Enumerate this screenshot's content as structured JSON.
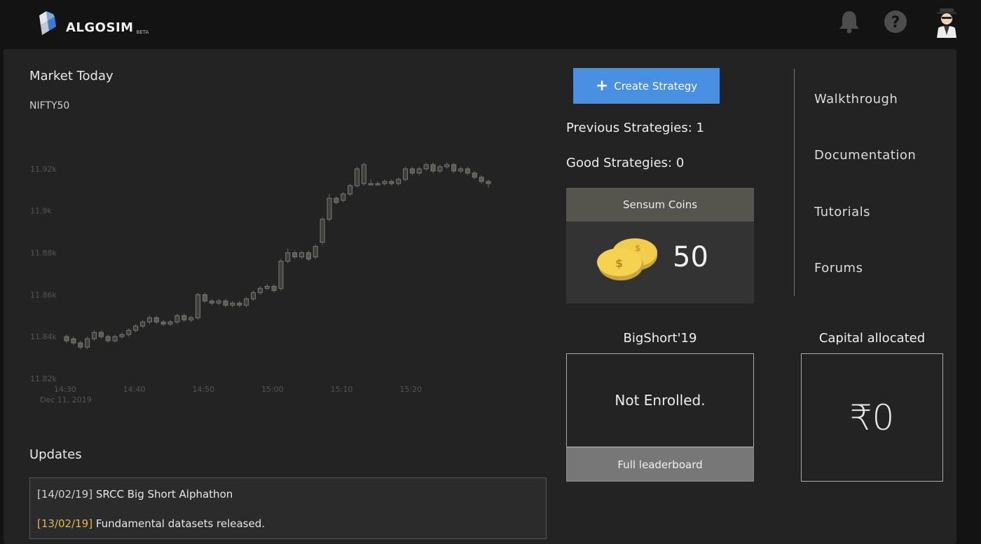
{
  "header": {
    "app_name": "ALGOSIM",
    "badge": "BETA"
  },
  "market": {
    "title": "Market Today",
    "index": "NIFTY50"
  },
  "chart_data": {
    "type": "candlestick",
    "x_date_label": "Dec 11, 2019",
    "x_ticks": [
      "14:30",
      "14:40",
      "14:50",
      "15:00",
      "15:10",
      "15:20"
    ],
    "y_ticks": [
      "11.82k",
      "11.84k",
      "11.86k",
      "11.88k",
      "11.9k",
      "11.92k"
    ],
    "ylim": [
      11820,
      11932
    ],
    "x_start_minute": 0,
    "x_end_minute": 60,
    "grid": false,
    "candles": [
      {
        "t": 0,
        "o": 11840,
        "c": 11838,
        "h": 11841,
        "l": 11837
      },
      {
        "t": 1,
        "o": 11839,
        "c": 11837,
        "h": 11840,
        "l": 11836
      },
      {
        "t": 2,
        "o": 11837,
        "c": 11835,
        "h": 11838,
        "l": 11834
      },
      {
        "t": 3,
        "o": 11835,
        "c": 11839,
        "h": 11840,
        "l": 11834
      },
      {
        "t": 4,
        "o": 11839,
        "c": 11842,
        "h": 11843,
        "l": 11838
      },
      {
        "t": 5,
        "o": 11842,
        "c": 11840,
        "h": 11843,
        "l": 11839
      },
      {
        "t": 6,
        "o": 11840,
        "c": 11838,
        "h": 11841,
        "l": 11837
      },
      {
        "t": 7,
        "o": 11838,
        "c": 11840,
        "h": 11841,
        "l": 11837
      },
      {
        "t": 8,
        "o": 11840,
        "c": 11841,
        "h": 11842,
        "l": 11839
      },
      {
        "t": 9,
        "o": 11841,
        "c": 11843,
        "h": 11844,
        "l": 11840
      },
      {
        "t": 10,
        "o": 11843,
        "c": 11845,
        "h": 11846,
        "l": 11842
      },
      {
        "t": 11,
        "o": 11845,
        "c": 11847,
        "h": 11848,
        "l": 11844
      },
      {
        "t": 12,
        "o": 11847,
        "c": 11849,
        "h": 11850,
        "l": 11846
      },
      {
        "t": 13,
        "o": 11849,
        "c": 11847,
        "h": 11850,
        "l": 11846
      },
      {
        "t": 14,
        "o": 11847,
        "c": 11846,
        "h": 11848,
        "l": 11845
      },
      {
        "t": 15,
        "o": 11846,
        "c": 11847,
        "h": 11848,
        "l": 11845
      },
      {
        "t": 16,
        "o": 11847,
        "c": 11850,
        "h": 11851,
        "l": 11846
      },
      {
        "t": 17,
        "o": 11850,
        "c": 11848,
        "h": 11851,
        "l": 11847
      },
      {
        "t": 18,
        "o": 11848,
        "c": 11849,
        "h": 11850,
        "l": 11847
      },
      {
        "t": 19,
        "o": 11849,
        "c": 11860,
        "h": 11861,
        "l": 11848
      },
      {
        "t": 20,
        "o": 11860,
        "c": 11857,
        "h": 11861,
        "l": 11856
      },
      {
        "t": 21,
        "o": 11857,
        "c": 11856,
        "h": 11858,
        "l": 11855
      },
      {
        "t": 22,
        "o": 11856,
        "c": 11857,
        "h": 11858,
        "l": 11855
      },
      {
        "t": 23,
        "o": 11857,
        "c": 11855,
        "h": 11858,
        "l": 11854
      },
      {
        "t": 24,
        "o": 11855,
        "c": 11856,
        "h": 11857,
        "l": 11854
      },
      {
        "t": 25,
        "o": 11856,
        "c": 11855,
        "h": 11857,
        "l": 11854
      },
      {
        "t": 26,
        "o": 11855,
        "c": 11858,
        "h": 11859,
        "l": 11854
      },
      {
        "t": 27,
        "o": 11858,
        "c": 11861,
        "h": 11862,
        "l": 11857
      },
      {
        "t": 28,
        "o": 11861,
        "c": 11863,
        "h": 11864,
        "l": 11860
      },
      {
        "t": 29,
        "o": 11863,
        "c": 11864,
        "h": 11865,
        "l": 11862
      },
      {
        "t": 30,
        "o": 11864,
        "c": 11862,
        "h": 11865,
        "l": 11861
      },
      {
        "t": 31,
        "o": 11863,
        "c": 11876,
        "h": 11877,
        "l": 11862
      },
      {
        "t": 32,
        "o": 11876,
        "c": 11880,
        "h": 11882,
        "l": 11875
      },
      {
        "t": 33,
        "o": 11880,
        "c": 11878,
        "h": 11881,
        "l": 11877
      },
      {
        "t": 34,
        "o": 11878,
        "c": 11880,
        "h": 11881,
        "l": 11877
      },
      {
        "t": 35,
        "o": 11880,
        "c": 11877,
        "h": 11881,
        "l": 11876
      },
      {
        "t": 36,
        "o": 11878,
        "c": 11883,
        "h": 11884,
        "l": 11877
      },
      {
        "t": 37,
        "o": 11885,
        "c": 11896,
        "h": 11897,
        "l": 11884
      },
      {
        "t": 38,
        "o": 11896,
        "c": 11906,
        "h": 11908,
        "l": 11895
      },
      {
        "t": 39,
        "o": 11906,
        "c": 11904,
        "h": 11907,
        "l": 11903
      },
      {
        "t": 40,
        "o": 11905,
        "c": 11908,
        "h": 11909,
        "l": 11904
      },
      {
        "t": 41,
        "o": 11908,
        "c": 11912,
        "h": 11913,
        "l": 11907
      },
      {
        "t": 42,
        "o": 11912,
        "c": 11920,
        "h": 11921,
        "l": 11911
      },
      {
        "t": 43,
        "o": 11913,
        "c": 11922,
        "h": 11923,
        "l": 11912
      },
      {
        "t": 44,
        "o": 11913,
        "c": 11913,
        "h": 11915,
        "l": 11912
      },
      {
        "t": 45,
        "o": 11913,
        "c": 11913,
        "h": 11914,
        "l": 11912
      },
      {
        "t": 46,
        "o": 11913,
        "c": 11914,
        "h": 11915,
        "l": 11912
      },
      {
        "t": 47,
        "o": 11914,
        "c": 11913,
        "h": 11915,
        "l": 11912
      },
      {
        "t": 48,
        "o": 11913,
        "c": 11915,
        "h": 11916,
        "l": 11912
      },
      {
        "t": 49,
        "o": 11915,
        "c": 11920,
        "h": 11921,
        "l": 11914
      },
      {
        "t": 50,
        "o": 11920,
        "c": 11918,
        "h": 11921,
        "l": 11917
      },
      {
        "t": 51,
        "o": 11918,
        "c": 11920,
        "h": 11921,
        "l": 11917
      },
      {
        "t": 52,
        "o": 11920,
        "c": 11922,
        "h": 11923,
        "l": 11919
      },
      {
        "t": 53,
        "o": 11922,
        "c": 11919,
        "h": 11923,
        "l": 11918
      },
      {
        "t": 54,
        "o": 11919,
        "c": 11921,
        "h": 11922,
        "l": 11918
      },
      {
        "t": 55,
        "o": 11921,
        "c": 11922,
        "h": 11923,
        "l": 11920
      },
      {
        "t": 56,
        "o": 11922,
        "c": 11919,
        "h": 11923,
        "l": 11918
      },
      {
        "t": 57,
        "o": 11919,
        "c": 11920,
        "h": 11921,
        "l": 11918
      },
      {
        "t": 58,
        "o": 11920,
        "c": 11918,
        "h": 11921,
        "l": 11917
      },
      {
        "t": 59,
        "o": 11918,
        "c": 11916,
        "h": 11919,
        "l": 11915
      },
      {
        "t": 60,
        "o": 11916,
        "c": 11914,
        "h": 11917,
        "l": 11913
      },
      {
        "t": 61,
        "o": 11914,
        "c": 11913,
        "h": 11915,
        "l": 11911
      }
    ]
  },
  "updates": {
    "title": "Updates",
    "items": [
      {
        "date": "[14/02/19]",
        "text": " SRCC Big Short Alphathon",
        "highlight": false
      },
      {
        "date": "[13/02/19]",
        "text": " Fundamental datasets released.",
        "highlight": true
      }
    ]
  },
  "strategies": {
    "create_label": "Create Strategy",
    "previous": "Previous Strategies: 1",
    "good": "Good Strategies: 0"
  },
  "coins": {
    "header": "Sensum Coins",
    "value": "50"
  },
  "links": [
    "Walkthrough",
    "Documentation",
    "Tutorials",
    "Forums"
  ],
  "bigshort": {
    "title": "BigShort'19",
    "status": "Not Enrolled.",
    "leaderboard_label": "Full leaderboard"
  },
  "capital": {
    "title": "Capital allocated",
    "value": "₹0"
  },
  "colors": {
    "accent": "#4a90e2",
    "highlight_date": "#e0b84a"
  }
}
